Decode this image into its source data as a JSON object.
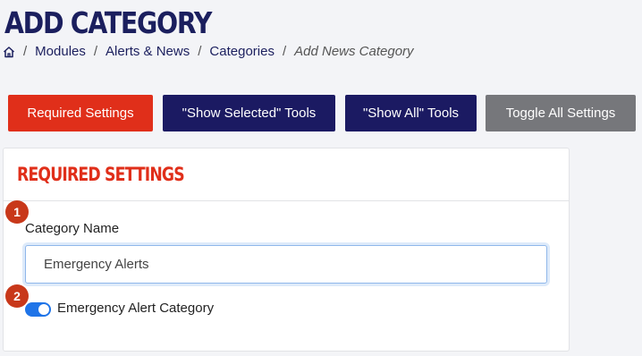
{
  "page": {
    "title": "ADD CATEGORY"
  },
  "breadcrumb": {
    "home_icon": "home-icon",
    "separator": "/",
    "items": [
      "Modules",
      "Alerts & News",
      "Categories"
    ],
    "current": "Add News Category"
  },
  "toolbar": {
    "required_settings_label": "Required Settings",
    "show_selected_tools_label": "\"Show Selected\" Tools",
    "show_all_tools_label": "\"Show All\" Tools",
    "toggle_all_settings_label": "Toggle All Settings"
  },
  "required_settings": {
    "title": "REQUIRED SETTINGS",
    "steps": [
      "1",
      "2"
    ],
    "category_name": {
      "label": "Category Name",
      "value": "Emergency Alerts"
    },
    "emergency_alert": {
      "label": "Emergency Alert Category",
      "enabled": true
    }
  },
  "colors": {
    "brand_navy": "#1b1f5e",
    "accent_red": "#e02f1a",
    "gray_button": "#76777b",
    "toggle_on": "#1f74e8"
  }
}
